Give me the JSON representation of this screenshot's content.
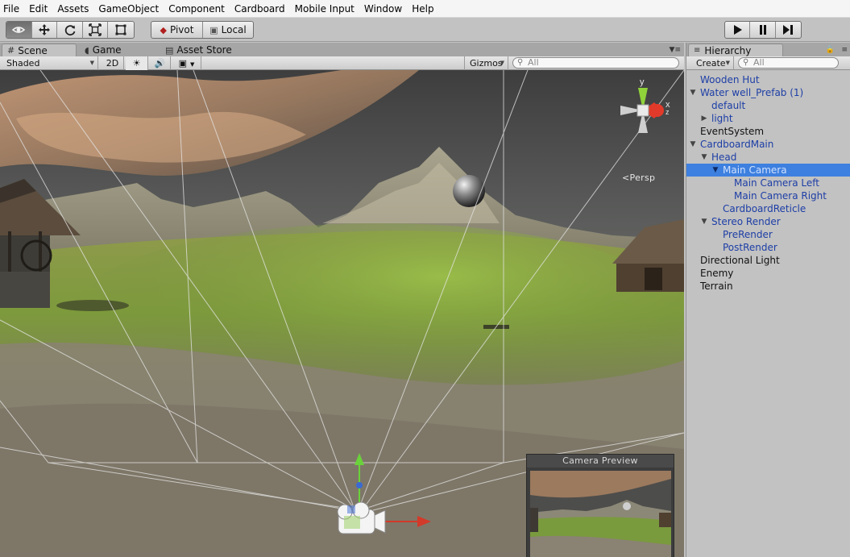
{
  "menu": [
    "File",
    "Edit",
    "Assets",
    "GameObject",
    "Component",
    "Cardboard",
    "Mobile Input",
    "Window",
    "Help"
  ],
  "toolbar": {
    "tools": [
      {
        "name": "hand-tool",
        "icon": "eye-icon",
        "active": true
      },
      {
        "name": "move-tool",
        "icon": "move-arrows-icon",
        "active": false
      },
      {
        "name": "rotate-tool",
        "icon": "rotate-icon",
        "active": false
      },
      {
        "name": "scale-tool",
        "icon": "scale-icon",
        "active": false
      },
      {
        "name": "rect-tool",
        "icon": "rect-icon",
        "active": false
      }
    ],
    "pivot_label": "Pivot",
    "local_label": "Local",
    "play": [
      "play-icon",
      "pause-icon",
      "step-icon"
    ]
  },
  "tabs": {
    "scene": "Scene",
    "game": "Game",
    "asset_store": "Asset Store"
  },
  "scene_toolbar": {
    "shading": "Shaded",
    "mode_2d": "2D",
    "gizmos": "Gizmos",
    "search_placeholder": "All"
  },
  "viewport": {
    "persp_label": "Persp",
    "gizmo_axes": {
      "y": "y",
      "x": "x",
      "z": "z"
    },
    "camera_preview_title": "Camera Preview"
  },
  "hierarchy": {
    "tab_label": "Hierarchy",
    "create_label": "Create",
    "search_placeholder": "All",
    "items": [
      {
        "label": "Wooden Hut",
        "depth": 0,
        "prefab": true,
        "toggle": ""
      },
      {
        "label": "Water well_Prefab (1)",
        "depth": 0,
        "prefab": true,
        "toggle": "expanded"
      },
      {
        "label": "default",
        "depth": 1,
        "prefab": true,
        "toggle": ""
      },
      {
        "label": "light",
        "depth": 1,
        "prefab": true,
        "toggle": "collapsed"
      },
      {
        "label": "EventSystem",
        "depth": 0,
        "prefab": false,
        "toggle": ""
      },
      {
        "label": "CardboardMain",
        "depth": 0,
        "prefab": true,
        "toggle": "expanded"
      },
      {
        "label": "Head",
        "depth": 1,
        "prefab": true,
        "toggle": "expanded"
      },
      {
        "label": "Main Camera",
        "depth": 2,
        "prefab": true,
        "toggle": "expanded",
        "selected": true
      },
      {
        "label": "Main Camera Left",
        "depth": 3,
        "prefab": true,
        "toggle": ""
      },
      {
        "label": "Main Camera Right",
        "depth": 3,
        "prefab": true,
        "toggle": ""
      },
      {
        "label": "CardboardReticle",
        "depth": 2,
        "prefab": true,
        "toggle": ""
      },
      {
        "label": "Stereo Render",
        "depth": 1,
        "prefab": true,
        "toggle": "expanded"
      },
      {
        "label": "PreRender",
        "depth": 2,
        "prefab": true,
        "toggle": ""
      },
      {
        "label": "PostRender",
        "depth": 2,
        "prefab": true,
        "toggle": ""
      },
      {
        "label": "Directional Light",
        "depth": 0,
        "prefab": false,
        "toggle": ""
      },
      {
        "label": "Enemy",
        "depth": 0,
        "prefab": false,
        "toggle": ""
      },
      {
        "label": "Terrain",
        "depth": 0,
        "prefab": false,
        "toggle": ""
      }
    ]
  },
  "colors": {
    "selection": "#3d80df",
    "prefab_text": "#1d3ea6",
    "panel_bg": "#c2c2c2"
  }
}
